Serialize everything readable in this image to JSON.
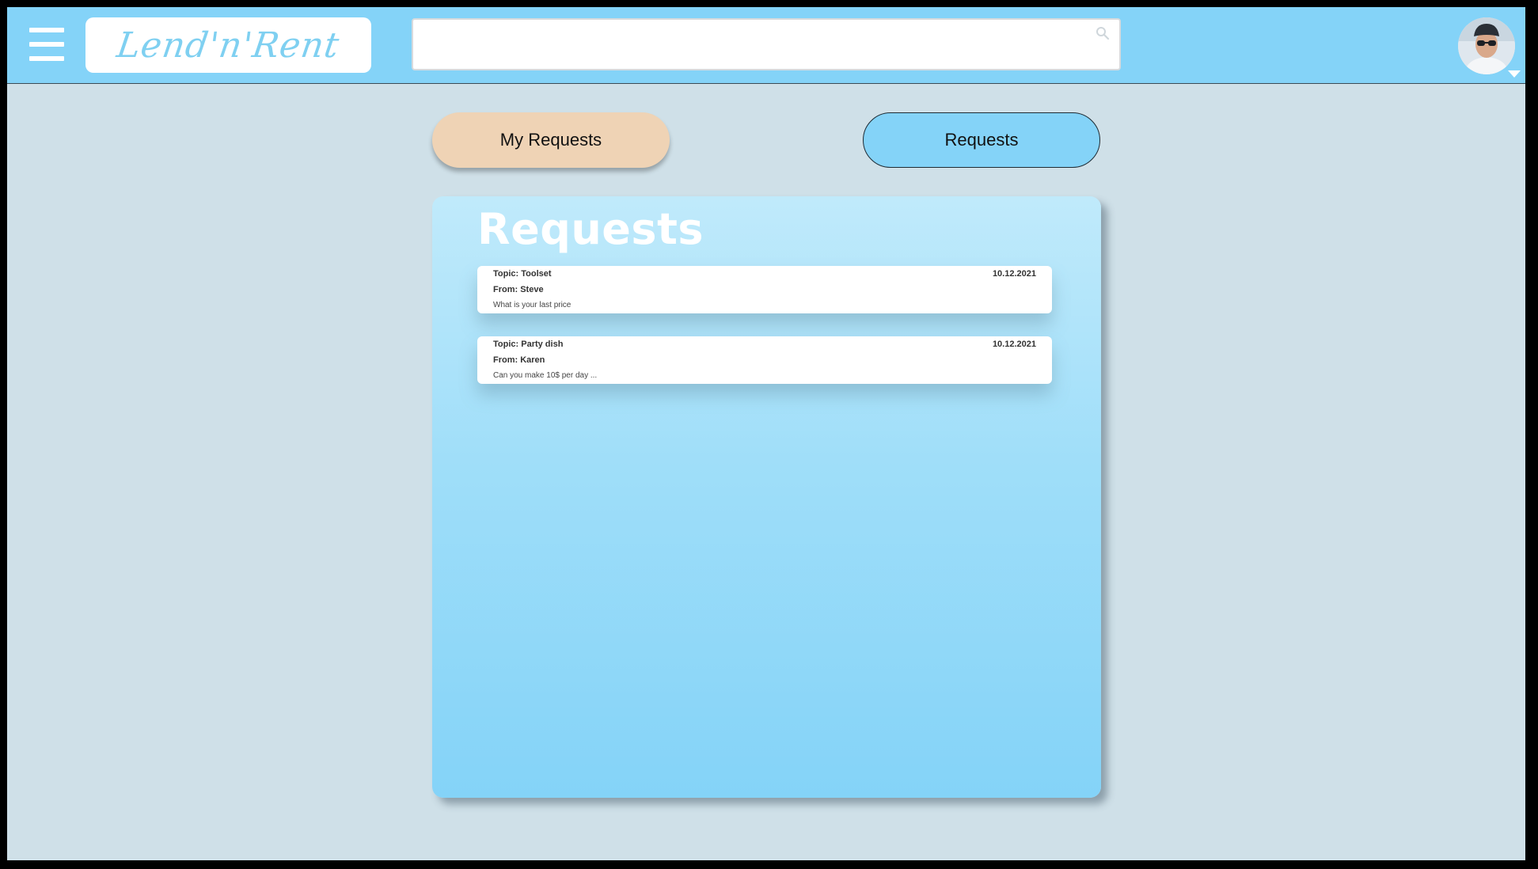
{
  "header": {
    "logo_text": "Lend'n'Rent",
    "search": {
      "value": "",
      "placeholder": ""
    },
    "icons": {
      "menu": "hamburger-menu-icon",
      "search": "search-icon",
      "avatar": "user-avatar",
      "caret": "caret-down-icon"
    }
  },
  "tabs": [
    {
      "label": "My Requests",
      "color": "#efd3b5",
      "active": false
    },
    {
      "label": "Requests",
      "color": "#84d3f8",
      "active": true
    }
  ],
  "panel": {
    "title": "Requests",
    "requests": [
      {
        "topic": "Topic: Toolset",
        "date": "10.12.2021",
        "from": "From: Steve",
        "message": "What is your last price"
      },
      {
        "topic": "Topic: Party dish",
        "date": "10.12.2021",
        "from": "From: Karen",
        "message": "Can you make 10$ per day ..."
      }
    ]
  },
  "colors": {
    "topbar": "#84d3f8",
    "background": "#cfe0e8",
    "accent": "#7fd0f1",
    "my_requests_button": "#efd3b5"
  }
}
